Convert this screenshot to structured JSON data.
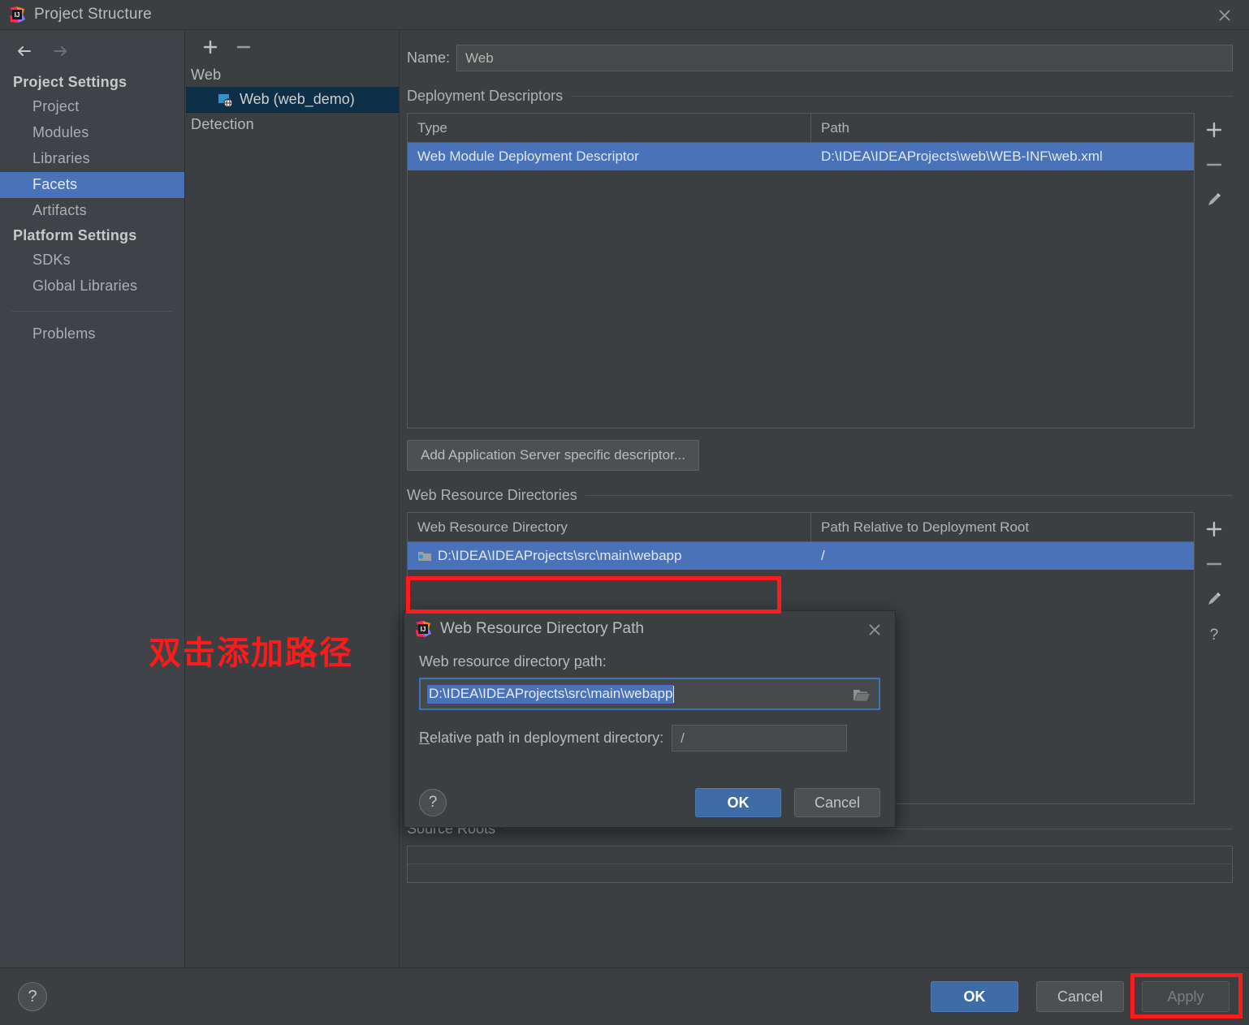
{
  "window": {
    "title": "Project Structure",
    "logo_icon": "intellij-idea-logo",
    "close_icon": "close-icon"
  },
  "navigation": {
    "back_icon": "arrow-left-icon",
    "forward_icon": "arrow-right-icon"
  },
  "sidebar": {
    "groups": [
      {
        "label": "Project Settings",
        "items": [
          {
            "label": "Project",
            "selected": false
          },
          {
            "label": "Modules",
            "selected": false
          },
          {
            "label": "Libraries",
            "selected": false
          },
          {
            "label": "Facets",
            "selected": true
          },
          {
            "label": "Artifacts",
            "selected": false
          }
        ]
      },
      {
        "label": "Platform Settings",
        "items": [
          {
            "label": "SDKs",
            "selected": false
          },
          {
            "label": "Global Libraries",
            "selected": false
          }
        ]
      }
    ],
    "extra_items": [
      {
        "label": "Problems",
        "selected": false
      }
    ]
  },
  "facet_panel": {
    "toolbar": {
      "add_icon": "plus-icon",
      "remove_icon": "minus-icon"
    },
    "tree": [
      {
        "label": "Web",
        "type": "group"
      },
      {
        "label": "Web (web_demo)",
        "type": "facet",
        "icon": "web-facet-icon",
        "selected": true
      },
      {
        "label": "Detection",
        "type": "group"
      }
    ]
  },
  "main": {
    "name_label": "Name:",
    "name_value": "Web",
    "deployment_descriptors": {
      "section_label": "Deployment Descriptors",
      "columns": [
        "Type",
        "Path"
      ],
      "rows": [
        {
          "type": "Web Module Deployment Descriptor",
          "path": "D:\\IDEA\\IDEAProjects\\web\\WEB-INF\\web.xml",
          "selected": true
        }
      ],
      "toolbar": [
        "plus-icon",
        "minus-icon",
        "pencil-icon"
      ],
      "add_button_label": "Add Application Server specific descriptor..."
    },
    "web_resource_directories": {
      "section_label": "Web Resource Directories",
      "columns": [
        "Web Resource Directory",
        "Path Relative to Deployment Root"
      ],
      "rows": [
        {
          "directory": "D:\\IDEA\\IDEAProjects\\src\\main\\webapp",
          "relative_path": "/",
          "icon": "folder-icon",
          "selected": true
        }
      ],
      "toolbar": [
        "plus-icon",
        "minus-icon",
        "pencil-icon",
        "question-icon"
      ]
    },
    "source_roots": {
      "section_label": "Source Roots"
    }
  },
  "modal": {
    "logo_icon": "intellij-idea-logo",
    "title": "Web Resource Directory Path",
    "close_icon": "close-icon",
    "path_label_prefix": "Web resource directory ",
    "path_label_mnemonic": "p",
    "path_label_suffix": "ath:",
    "path_value": "D:\\IDEA\\IDEAProjects\\src\\main\\webapp",
    "browse_icon": "folder-open-icon",
    "relative_label_mnemonic": "R",
    "relative_label_rest": "elative path in deployment directory:",
    "relative_value": "/",
    "help_label": "?",
    "ok_label": "OK",
    "cancel_label": "Cancel"
  },
  "footer": {
    "help_label": "?",
    "ok_label": "OK",
    "cancel_label": "Cancel",
    "apply_label": "Apply",
    "apply_enabled": false
  },
  "annotations": {
    "note_text": "双击添加路径",
    "note_color": "#fd1a1a",
    "highlight_color": "#fe1b1b"
  },
  "colors": {
    "window_bg": "#3c3f41",
    "sidebar_bg": "#3f4246",
    "selection_blue": "#4a72b8",
    "tree_selection": "#0d2f48",
    "primary_button": "#3f6ba6"
  }
}
